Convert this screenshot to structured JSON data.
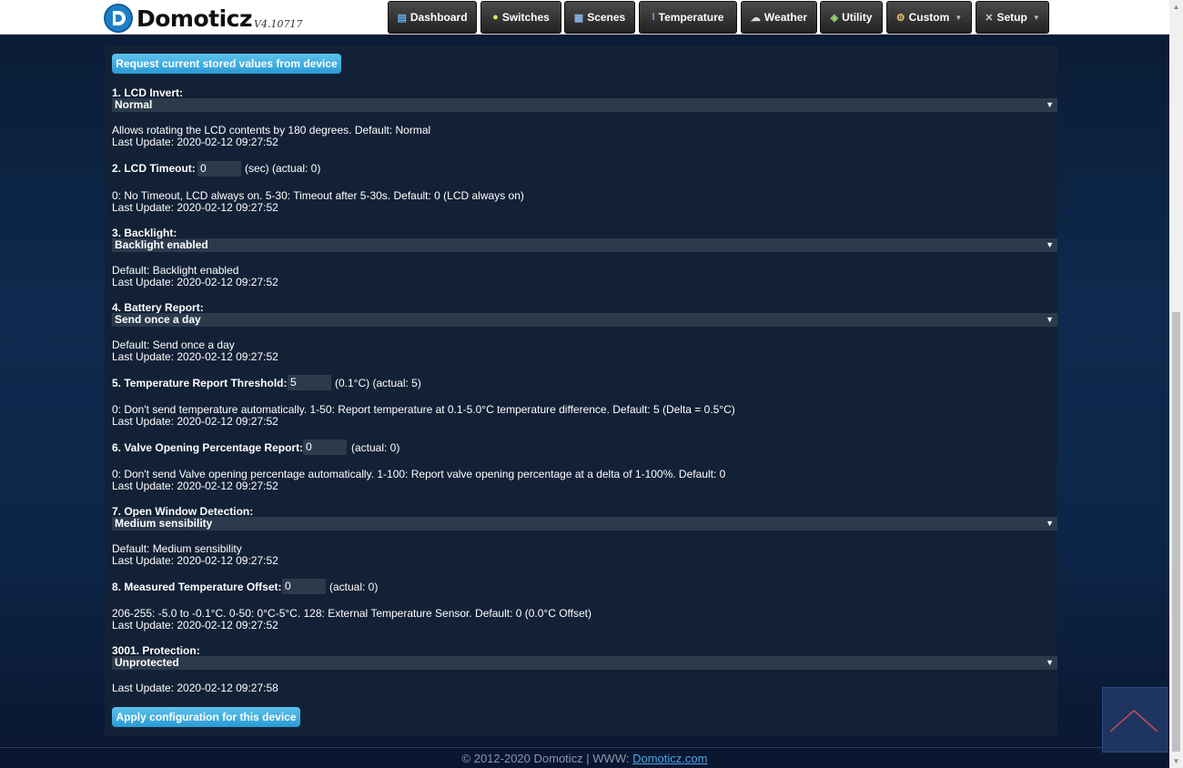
{
  "header": {
    "logo_text": "Domoticz",
    "version": "V4.10717",
    "nav": [
      {
        "label": "Dashboard",
        "icon": "dashboard-icon"
      },
      {
        "label": "Switches",
        "icon": "lightbulb-icon"
      },
      {
        "label": "Scenes",
        "icon": "scenes-icon"
      },
      {
        "label": "Temperature",
        "icon": "thermometer-icon"
      },
      {
        "label": "Weather",
        "icon": "cloud-icon"
      },
      {
        "label": "Utility",
        "icon": "utility-icon"
      },
      {
        "label": "Custom",
        "icon": "gear-icon"
      },
      {
        "label": "Setup",
        "icon": "tools-icon"
      }
    ]
  },
  "main": {
    "request_button": "Request current stored values from device",
    "apply_button": "Apply configuration for this device",
    "params": [
      {
        "label": "1. LCD Invert:",
        "value": "Normal",
        "desc": "Allows rotating the LCD contents by 180 degrees. Default: Normal",
        "update": "Last Update: 2020-02-12 09:27:52"
      },
      {
        "label": "2. LCD Timeout:",
        "value": "0",
        "after": "(sec) (actual: 0)",
        "desc": "0: No Timeout, LCD always on. 5-30: Timeout after 5-30s. Default: 0 (LCD always on)",
        "update": "Last Update: 2020-02-12 09:27:52"
      },
      {
        "label": "3. Backlight:",
        "value": "Backlight enabled",
        "desc": "Default: Backlight enabled",
        "update": "Last Update: 2020-02-12 09:27:52"
      },
      {
        "label": "4. Battery Report:",
        "value": "Send once a day",
        "desc": "Default: Send once a day",
        "update": "Last Update: 2020-02-12 09:27:52"
      },
      {
        "label": "5. Temperature Report Threshold:",
        "value": "5",
        "after": "(0.1°C) (actual: 5)",
        "desc": "0: Don't send temperature automatically. 1-50: Report temperature at 0.1-5.0°C temperature difference. Default: 5 (Delta = 0.5°C)",
        "update": "Last Update: 2020-02-12 09:27:52"
      },
      {
        "label": "6. Valve Opening Percentage Report:",
        "value": "0",
        "after": "(actual: 0)",
        "desc": "0: Don't send Valve opening percentage automatically. 1-100: Report valve opening percentage at a delta of 1-100%. Default: 0",
        "update": "Last Update: 2020-02-12 09:27:52"
      },
      {
        "label": "7. Open Window Detection:",
        "value": "Medium sensibility",
        "desc": "Default: Medium sensibility",
        "update": "Last Update: 2020-02-12 09:27:52"
      },
      {
        "label": "8. Measured Temperature Offset:",
        "value": "0",
        "after": "(actual: 0)",
        "desc": "206-255: -5.0 to -0.1°C. 0-50: 0°C-5°C. 128: External Temperature Sensor. Default: 0 (0.0°C Offset)",
        "update": "Last Update: 2020-02-12 09:27:52"
      },
      {
        "label": "3001. Protection:",
        "value": "Unprotected",
        "update": "Last Update: 2020-02-12 09:27:58"
      }
    ]
  },
  "footer": {
    "text": "© 2012-2020 Domoticz | WWW: ",
    "link": "Domoticz.com"
  }
}
